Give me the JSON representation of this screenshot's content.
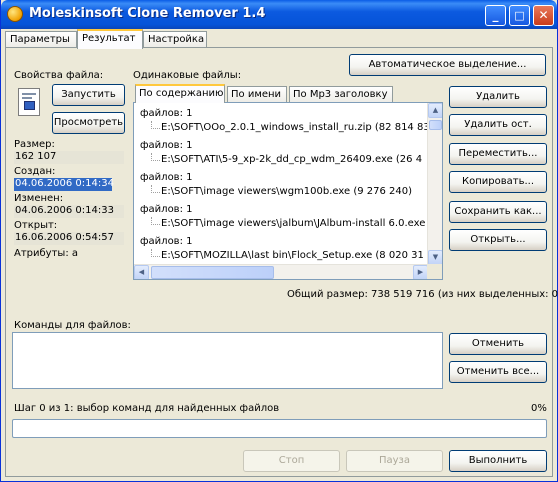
{
  "window": {
    "title": "Moleskinsoft Clone Remover 1.4",
    "controls": {
      "minimize": "_",
      "maximize": "□",
      "close": "✕"
    },
    "icon": "app-icon"
  },
  "tabs": [
    "Параметры",
    "Результат",
    "Настройка"
  ],
  "active_tab": "Результат",
  "file_props": {
    "label": "Свойства файла:",
    "run_button": "Запустить",
    "view_button": "Просмотреть",
    "size_label": "Размер:",
    "size_value": "162 107",
    "created_label": "Создан:",
    "created_value": "04.06.2006 0:14:34",
    "modified_label": "Изменен:",
    "modified_value": "04.06.2006 0:14:33",
    "opened_label": "Открыт:",
    "opened_value": "16.06.2006 0:54:57",
    "attributes": "Атрибуты: а"
  },
  "same_files": {
    "label": "Одинаковые файлы:",
    "subtabs": [
      "По содержанию",
      "По имени",
      "По Mp3 заголовку"
    ],
    "active_subtab": "По содержанию",
    "groups": [
      {
        "header": "файлов: 1",
        "file": "E:\\SOFT\\OOo_2.0.1_windows_install_ru.zip (82 814 83"
      },
      {
        "header": "файлов: 1",
        "file": "E:\\SOFT\\ATI\\5-9_xp-2k_dd_cp_wdm_26409.exe (26 4"
      },
      {
        "header": "файлов: 1",
        "file": "E:\\SOFT\\image viewers\\wgm100b.exe (9 276 240)"
      },
      {
        "header": "файлов: 1",
        "file": "E:\\SOFT\\image viewers\\jalbum\\JAlbum-install 6.0.exe (8"
      },
      {
        "header": "файлов: 1",
        "file": "E:\\SOFT\\MOZILLA\\last bin\\Flock_Setup.exe (8 020 31"
      }
    ]
  },
  "actions": {
    "auto_select": "Автоматическое выделение...",
    "delete": "Удалить",
    "delete_rest": "Удалить ост.",
    "move": "Переместить...",
    "copy": "Копировать...",
    "save_as": "Сохранить как...",
    "open": "Открыть..."
  },
  "total_size": "Общий размер: 738 519 716 (из них выделенных: 0)",
  "commands": {
    "label": "Команды для файлов:",
    "cancel": "Отменить",
    "cancel_all": "Отменить все..."
  },
  "progress": {
    "step_text": "Шаг 0 из 1: выбор команд для найденных файлов",
    "percent_text": "0%",
    "value": 0
  },
  "footer": {
    "stop": "Стоп",
    "pause": "Пауза",
    "execute": "Выполнить"
  },
  "colors": {
    "titlebar": "#0553d8",
    "selection": "#316ac5",
    "window_bg": "#ece9d8"
  }
}
